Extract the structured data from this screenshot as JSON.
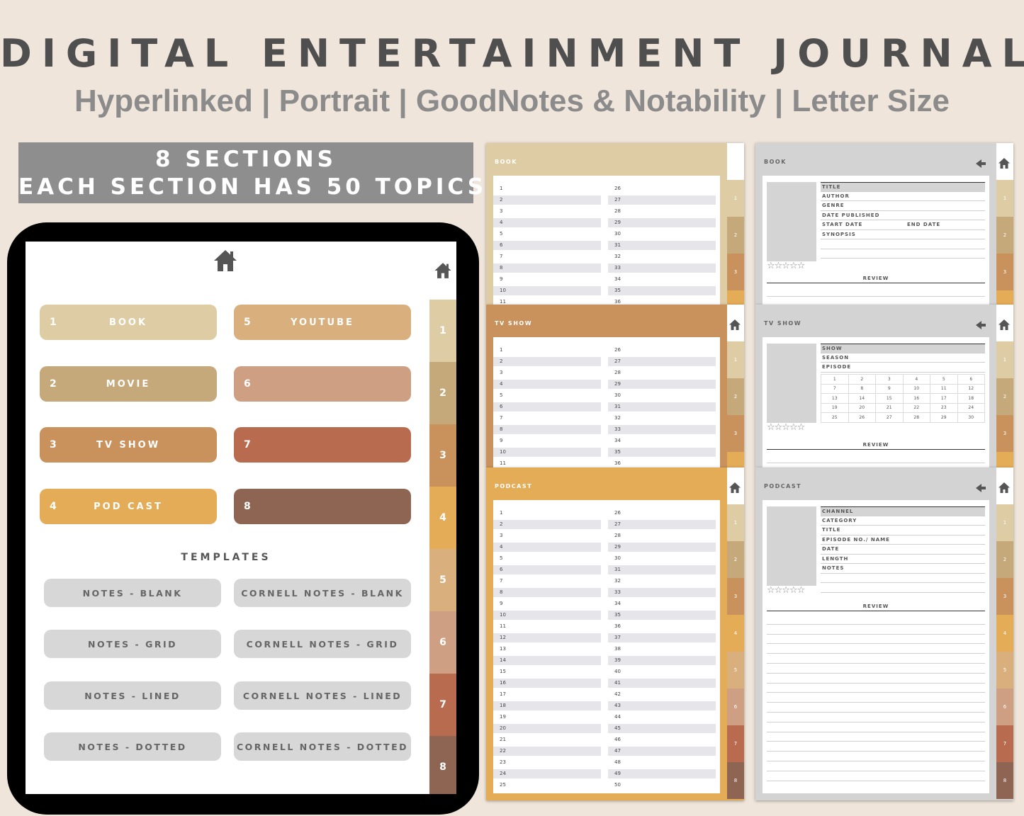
{
  "header": {
    "title": "DIGITAL ENTERTAINMENT JOURNAL",
    "subtitle": "Hyperlinked | Portrait | GoodNotes & Notability | Letter Size"
  },
  "banner": {
    "line1": "8 SECTIONS",
    "line2": "EACH SECTION HAS 50 TOPICS"
  },
  "colors": {
    "c1": "#decda4",
    "c2": "#c6a97b",
    "c3": "#c9915c",
    "c4": "#e5ac58",
    "c5": "#d9b07d",
    "c6": "#cf9f84",
    "c7": "#b86b4e",
    "c8": "#8e6552"
  },
  "tablet": {
    "home_icon": "home-icon",
    "tabs": [
      "1",
      "2",
      "3",
      "4",
      "5",
      "6",
      "7",
      "8"
    ],
    "sections": [
      {
        "num": "1",
        "label": "BOOK"
      },
      {
        "num": "2",
        "label": "MOVIE"
      },
      {
        "num": "3",
        "label": "TV SHOW"
      },
      {
        "num": "4",
        "label": "POD CAST"
      },
      {
        "num": "5",
        "label": "YOUTUBE"
      },
      {
        "num": "6",
        "label": ""
      },
      {
        "num": "7",
        "label": ""
      },
      {
        "num": "8",
        "label": ""
      }
    ],
    "templates_title": "TEMPLATES",
    "templates": [
      "NOTES - BLANK",
      "CORNELL NOTES - BLANK",
      "NOTES - GRID",
      "CORNELL NOTES - GRID",
      "NOTES - LINED",
      "CORNELL NOTES - LINED",
      "NOTES - DOTTED",
      "CORNELL NOTES - DOTTED"
    ]
  },
  "pages": {
    "book_list": {
      "title": "BOOK",
      "side_tabs": [
        "1",
        "2",
        "3"
      ]
    },
    "tv_list": {
      "title": "TV SHOW",
      "side_tabs": [
        "1",
        "2",
        "3"
      ]
    },
    "podcast_list": {
      "title": "PODCAST",
      "side_tabs": [
        "1",
        "2",
        "3",
        "4",
        "5",
        "6",
        "7",
        "8"
      ]
    },
    "book_detail": {
      "title": "BOOK",
      "fields": [
        "TITLE",
        "AUTHOR",
        "GENRE",
        "DATE PUBLISHED",
        "START DATE",
        "SYNOPSIS"
      ],
      "end_date": "END DATE",
      "stars": "☆☆☆☆☆",
      "review": "REVIEW"
    },
    "tv_detail": {
      "title": "TV SHOW",
      "fields": [
        "SHOW",
        "SEASON",
        "EPISODE"
      ],
      "episodes": [
        "1",
        "2",
        "3",
        "4",
        "5",
        "6",
        "7",
        "8",
        "9",
        "10",
        "11",
        "12",
        "13",
        "14",
        "15",
        "16",
        "17",
        "18",
        "19",
        "20",
        "21",
        "22",
        "23",
        "24",
        "25",
        "26",
        "27",
        "28",
        "29",
        "30"
      ],
      "stars": "☆☆☆☆☆",
      "review": "REVIEW"
    },
    "podcast_detail": {
      "title": "PODCAST",
      "fields": [
        "CHANNEL",
        "CATEGORY",
        "TITLE",
        "EPISODE NO./ NAME",
        "DATE",
        "LENGTH",
        "NOTES"
      ],
      "stars": "☆☆☆☆☆",
      "review": "REVIEW"
    }
  }
}
